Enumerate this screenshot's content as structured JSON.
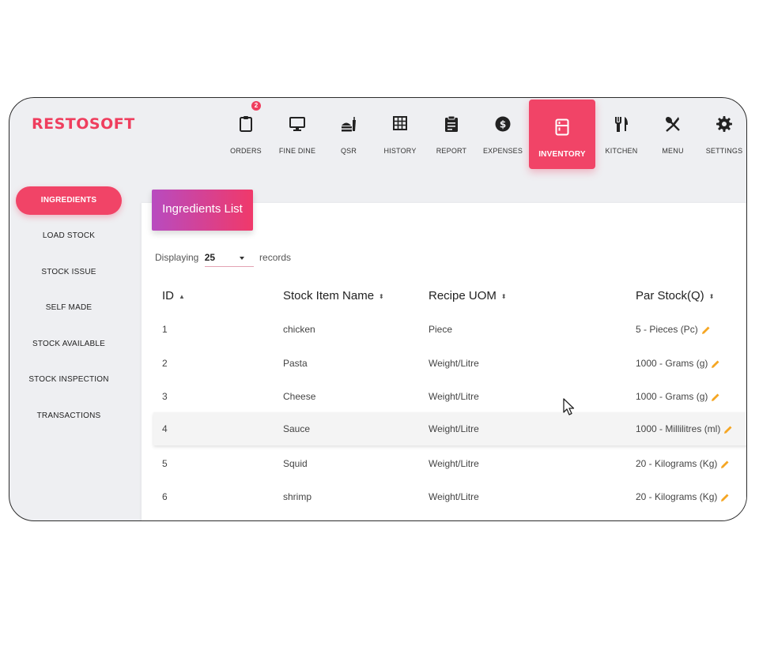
{
  "brand": "RESTOSOFT",
  "nav": [
    {
      "label": "ORDERS",
      "icon": "clipboard-icon",
      "badge": "2"
    },
    {
      "label": "FINE DINE",
      "icon": "monitor-icon"
    },
    {
      "label": "QSR",
      "icon": "fast-food-icon"
    },
    {
      "label": "HISTORY",
      "icon": "grid-icon"
    },
    {
      "label": "REPORT",
      "icon": "report-icon"
    },
    {
      "label": "EXPENSES",
      "icon": "dollar-icon"
    },
    {
      "label": "INVENTORY",
      "icon": "fridge-icon",
      "active": true
    },
    {
      "label": "KITCHEN",
      "icon": "utensils-icon"
    },
    {
      "label": "MENU",
      "icon": "spoon-knife-icon"
    },
    {
      "label": "SETTINGS",
      "icon": "gear-icon"
    }
  ],
  "sidebar": [
    {
      "label": "INGREDIENTS",
      "active": true
    },
    {
      "label": "LOAD STOCK"
    },
    {
      "label": "STOCK ISSUE"
    },
    {
      "label": "SELF MADE"
    },
    {
      "label": "STOCK AVAILABLE"
    },
    {
      "label": "STOCK INSPECTION"
    },
    {
      "label": "TRANSACTIONS"
    }
  ],
  "panel": {
    "title": "Ingredients List",
    "displaying_label": "Displaying",
    "page_size": "25",
    "records_label": "records"
  },
  "table": {
    "headers": [
      "ID",
      "Stock Item Name",
      "Recipe UOM",
      "Par Stock(Q)"
    ],
    "rows": [
      [
        "1",
        "chicken",
        "Piece",
        "5 - Pieces (Pc)"
      ],
      [
        "2",
        "Pasta",
        "Weight/Litre",
        "1000 - Grams (g)"
      ],
      [
        "3",
        "Cheese",
        "Weight/Litre",
        "1000 - Grams (g)"
      ],
      [
        "4",
        "Sauce",
        "Weight/Litre",
        "1000 - Millilitres (ml)"
      ],
      [
        "5",
        "Squid",
        "Weight/Litre",
        "20 - Kilograms (Kg)"
      ],
      [
        "6",
        "shrimp",
        "Weight/Litre",
        "20 - Kilograms (Kg)"
      ]
    ]
  },
  "colors": {
    "accent": "#f14467",
    "brand": "#ef3e5e",
    "edit": "#f5a623"
  }
}
